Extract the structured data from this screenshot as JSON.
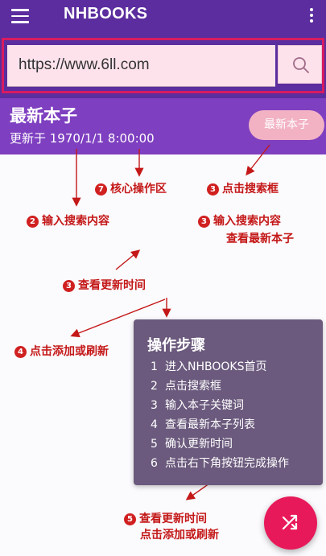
{
  "appbar": {
    "title": "NHBOOKS"
  },
  "search": {
    "value": "https://www.6ll.com"
  },
  "section": {
    "title": "最新本子",
    "updated": "更新于 1970/1/1 8:00:00",
    "button_label": "最新本子"
  },
  "annotations": {
    "core": {
      "num": "7",
      "text": "核心操作区"
    },
    "click_search": {
      "num": "3",
      "text": "点击搜索框"
    },
    "input_content": {
      "num": "2",
      "text": "输入搜索内容"
    },
    "input_latest": {
      "num": "3",
      "text": "输入搜索内容",
      "line2": "查看最新本子"
    },
    "view_time": {
      "num": "3",
      "text": "查看更新时间"
    },
    "add_refresh": {
      "num": "4",
      "text": "点击添加或刷新"
    },
    "bottom": {
      "num": "5",
      "text": "查看更新时间",
      "line2": "点击添加或刷新"
    }
  },
  "steps": {
    "title": "操作步骤",
    "items": [
      {
        "n": "1",
        "text": "进入NHBOOKS首页"
      },
      {
        "n": "2",
        "text": "点击搜索框"
      },
      {
        "n": "3",
        "text": "输入本子关键词"
      },
      {
        "n": "4",
        "text": "查看最新本子列表"
      },
      {
        "n": "5",
        "text": "确认更新时间"
      },
      {
        "n": "6",
        "text": "点击右下角按钮完成操作"
      }
    ]
  },
  "icons": {
    "menu": "hamburger-icon",
    "more": "more-vert-icon",
    "search": "search-icon",
    "fab": "shuffle-icon"
  },
  "colors": {
    "primary": "#5b2d9e",
    "section": "#7e3fc0",
    "accent": "#e8195a",
    "annotation": "#c41818",
    "highlight": "#d81b60"
  }
}
